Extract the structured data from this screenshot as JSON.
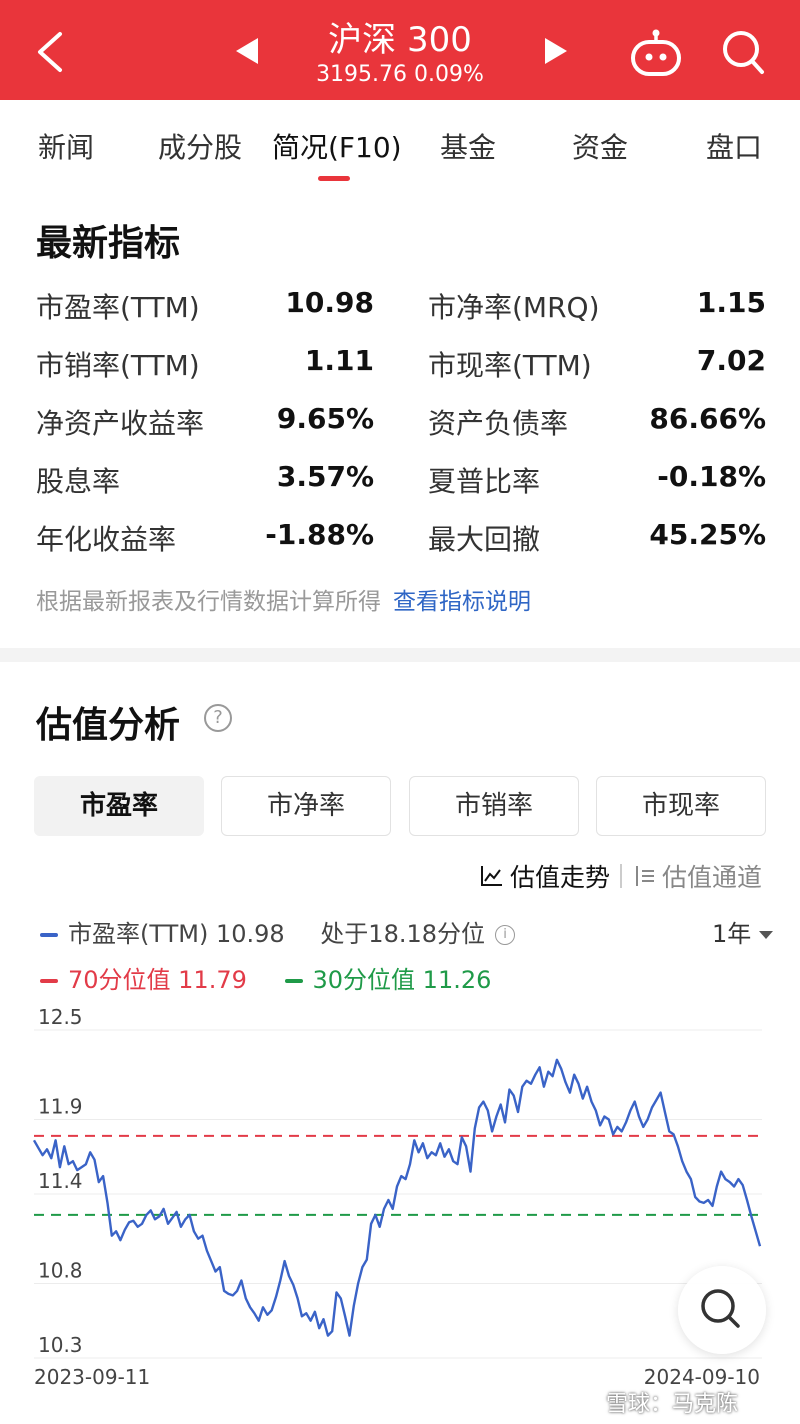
{
  "header": {
    "title": "沪深 300",
    "subtitle": "3195.76 0.09%"
  },
  "tabs": [
    {
      "label": "新闻"
    },
    {
      "label": "成分股"
    },
    {
      "label": "简况(F10)"
    },
    {
      "label": "基金"
    },
    {
      "label": "资金"
    },
    {
      "label": "盘口"
    }
  ],
  "metrics": {
    "title": "最新指标",
    "rows": [
      {
        "l1": "市盈率(TTM)",
        "v1": "10.98",
        "l2": "市净率(MRQ)",
        "v2": "1.15"
      },
      {
        "l1": "市销率(TTM)",
        "v1": "1.11",
        "l2": "市现率(TTM)",
        "v2": "7.02"
      },
      {
        "l1": "净资产收益率",
        "v1": "9.65%",
        "l2": "资产负债率",
        "v2": "86.66%"
      },
      {
        "l1": "股息率",
        "v1": "3.57%",
        "l2": "夏普比率",
        "v2": "-0.18%"
      },
      {
        "l1": "年化收益率",
        "v1": "-1.88%",
        "l2": "最大回撤",
        "v2": "45.25%"
      }
    ],
    "note": "根据最新报表及行情数据计算所得",
    "note_link": "查看指标说明"
  },
  "valuation": {
    "title": "估值分析",
    "help_icon": "?",
    "segments": [
      "市盈率",
      "市净率",
      "市销率",
      "市现率"
    ],
    "toggle_trend": "估值走势",
    "toggle_channel": "估值通道",
    "legend": {
      "main": "市盈率(TTM) 10.98",
      "percentile": "处于18.18分位",
      "p70": "70分位值 11.79",
      "p30": "30分位值 11.26"
    },
    "period": "1年"
  },
  "chart_data": {
    "type": "line",
    "x_start": "2023-09-11",
    "x_end": "2024-09-10",
    "y_ticks": [
      "12.5",
      "11.9",
      "11.4",
      "10.8",
      "10.3"
    ],
    "ylim": [
      10.3,
      12.5
    ],
    "reference_lines": [
      {
        "name": "70分位值",
        "value": 11.79,
        "color": "#e23b48"
      },
      {
        "name": "30分位值",
        "value": 11.26,
        "color": "#1f9a48"
      }
    ],
    "series": [
      {
        "name": "市盈率(TTM)",
        "color": "#3a63c7",
        "values": [
          11.76,
          11.71,
          11.66,
          11.7,
          11.64,
          11.76,
          11.58,
          11.72,
          11.6,
          11.62,
          11.56,
          11.58,
          11.6,
          11.68,
          11.63,
          11.48,
          11.52,
          11.34,
          11.12,
          11.15,
          11.09,
          11.16,
          11.21,
          11.22,
          11.18,
          11.2,
          11.26,
          11.29,
          11.23,
          11.25,
          11.3,
          11.2,
          11.24,
          11.28,
          11.18,
          11.23,
          11.26,
          11.15,
          11.1,
          11.12,
          11.02,
          10.95,
          10.88,
          10.91,
          10.75,
          10.73,
          10.72,
          10.75,
          10.82,
          10.7,
          10.64,
          10.6,
          10.55,
          10.64,
          10.59,
          10.62,
          10.71,
          10.82,
          10.95,
          10.85,
          10.79,
          10.7,
          10.58,
          10.6,
          10.55,
          10.61,
          10.5,
          10.56,
          10.45,
          10.48,
          10.74,
          10.7,
          10.58,
          10.45,
          10.65,
          10.8,
          10.91,
          10.96,
          11.2,
          11.26,
          11.18,
          11.3,
          11.36,
          11.3,
          11.45,
          11.52,
          11.5,
          11.6,
          11.76,
          11.68,
          11.74,
          11.64,
          11.68,
          11.66,
          11.74,
          11.65,
          11.7,
          11.62,
          11.6,
          11.78,
          11.72,
          11.55,
          11.84,
          11.98,
          12.02,
          11.96,
          11.82,
          11.92,
          12.0,
          11.88,
          12.1,
          12.06,
          11.95,
          12.12,
          12.16,
          12.14,
          12.2,
          12.25,
          12.12,
          12.22,
          12.19,
          12.3,
          12.24,
          12.15,
          12.08,
          12.2,
          12.14,
          12.04,
          12.12,
          12.02,
          11.96,
          11.86,
          11.92,
          11.9,
          11.8,
          11.85,
          11.82,
          11.88,
          11.96,
          12.02,
          11.92,
          11.85,
          11.9,
          11.98,
          12.03,
          12.08,
          11.95,
          11.82,
          11.8,
          11.72,
          11.62,
          11.55,
          11.5,
          11.38,
          11.35,
          11.34,
          11.36,
          11.32,
          11.45,
          11.55,
          11.5,
          11.48,
          11.45,
          11.5,
          11.46,
          11.36,
          11.25,
          11.15,
          11.05
        ]
      }
    ]
  }
}
